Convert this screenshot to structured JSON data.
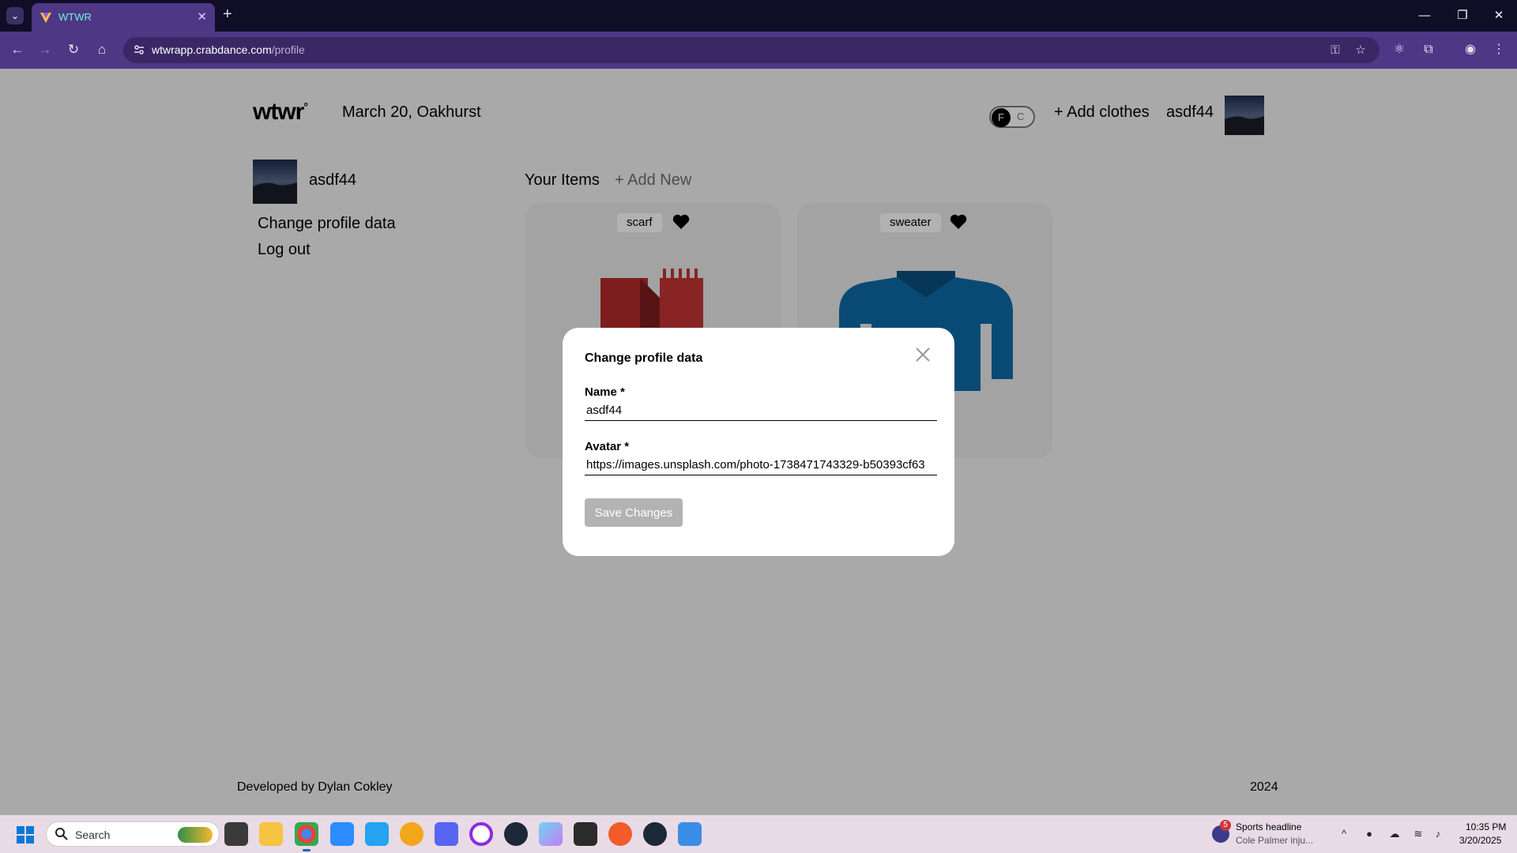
{
  "browser": {
    "tab_title": "WTWR",
    "url_host": "wtwrapp.crabdance.com",
    "url_path": "/profile"
  },
  "header": {
    "logo": "wtwr",
    "logo_mark": "°",
    "date_location": "March 20, Oakhurst",
    "toggle_f": "F",
    "toggle_c": "C",
    "add_clothes": "+ Add clothes",
    "username": "asdf44"
  },
  "sidebar": {
    "username": "asdf44",
    "change_profile": "Change profile data",
    "logout": "Log out"
  },
  "items": {
    "heading": "Your Items",
    "add_new": "+ Add New",
    "cards": [
      {
        "label": "scarf",
        "color": "#b52a2a"
      },
      {
        "label": "sweater",
        "color": "#0e6aa8"
      }
    ]
  },
  "modal": {
    "title": "Change profile data",
    "name_label": "Name *",
    "name_value": "asdf44",
    "avatar_label": "Avatar *",
    "avatar_value": "https://images.unsplash.com/photo-1738471743329-b50393cf63",
    "save_label": "Save Changes"
  },
  "footer": {
    "developer": "Developed by Dylan Cokley",
    "year": "2024"
  },
  "taskbar": {
    "search_placeholder": "Search",
    "news_title": "Sports headline",
    "news_sub": "Cole Palmer inju...",
    "news_badge": "5",
    "time": "10:35 PM",
    "date": "3/20/2025"
  },
  "colors": {
    "browser_frame": "#100d27",
    "toolbar": "#4e3785",
    "accent_tab_text": "#6ef0e4",
    "save_disabled": "#b3b3b3"
  }
}
